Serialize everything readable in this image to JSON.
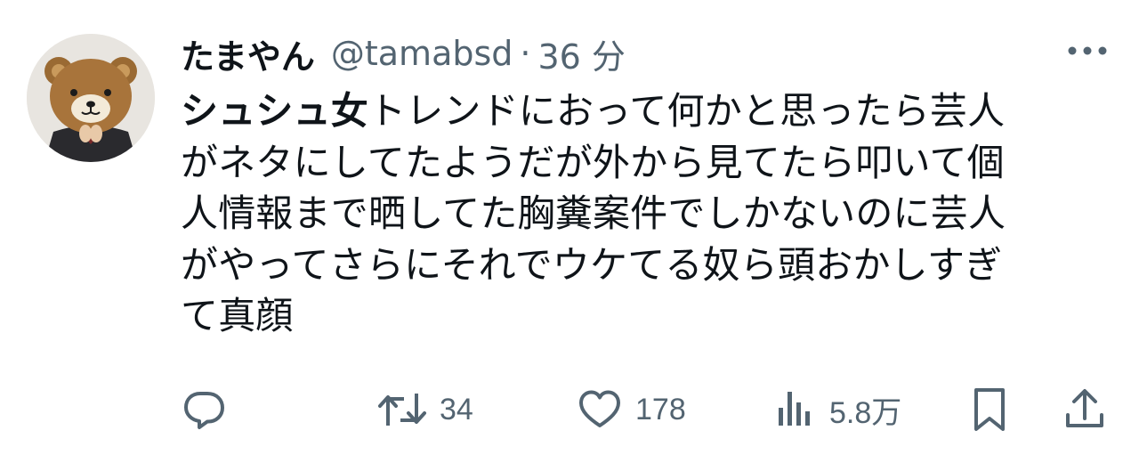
{
  "tweet": {
    "author": {
      "display_name": "たまやん",
      "handle": "@tamabsd",
      "avatar_icon": "bear-mascot-avatar"
    },
    "separator": "·",
    "time": "36 分",
    "text_lines": [
      {
        "bold": "シュシュ女",
        "rest": "トレンドにおって何かと思ったら芸人"
      },
      {
        "bold": "",
        "rest": "がネタにしてたようだが外から見てたら叩いて個"
      },
      {
        "bold": "",
        "rest": "人情報まで晒してた胸糞案件でしかないのに芸人"
      },
      {
        "bold": "",
        "rest": "がやってさらにそれでウケてる奴ら頭おかしすぎ"
      },
      {
        "bold": "",
        "rest": "て真顔"
      }
    ],
    "actions": {
      "reply": {
        "icon": "reply-icon",
        "count": ""
      },
      "retweet": {
        "icon": "retweet-icon",
        "count": "34"
      },
      "like": {
        "icon": "heart-icon",
        "count": "178"
      },
      "views": {
        "icon": "views-icon",
        "count": "5.8万"
      },
      "bookmark": {
        "icon": "bookmark-icon"
      },
      "share": {
        "icon": "share-icon"
      }
    },
    "colors": {
      "text": "#0f1419",
      "secondary": "#536471"
    }
  }
}
